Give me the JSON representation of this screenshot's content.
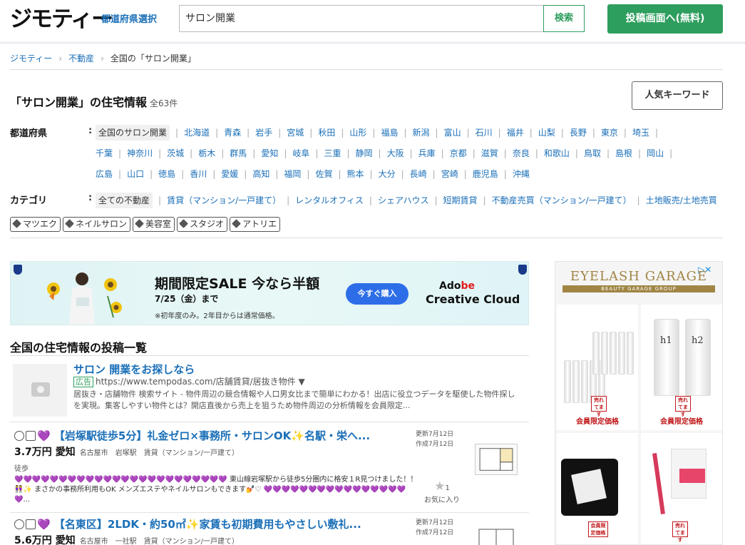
{
  "header": {
    "logo": "ジモティー",
    "pref_select": "都道府県選択",
    "search_value": "サロン開業",
    "search_btn": "検索",
    "post_btn": "投稿画面へ(無料)"
  },
  "breadcrumb": [
    "ジモティー",
    "不動産",
    "全国の「サロン開業」"
  ],
  "page": {
    "title": "「サロン開業」の住宅情報",
    "count": "全63件",
    "popular_btn": "人気キーワード"
  },
  "filters": {
    "pref_label": "都道府県",
    "pref_current": "全国のサロン開業",
    "pref_line1": [
      "北海道",
      "青森",
      "岩手",
      "宮城",
      "秋田",
      "山形",
      "福島",
      "新潟",
      "富山",
      "石川",
      "福井",
      "山梨",
      "長野",
      "東京",
      "埼玉"
    ],
    "pref_line2": [
      "千葉",
      "神奈川",
      "茨城",
      "栃木",
      "群馬",
      "愛知",
      "岐阜",
      "三重",
      "静岡",
      "大阪",
      "兵庫",
      "京都",
      "滋賀",
      "奈良",
      "和歌山",
      "鳥取",
      "島根",
      "岡山"
    ],
    "pref_line3": [
      "広島",
      "山口",
      "徳島",
      "香川",
      "愛媛",
      "高知",
      "福岡",
      "佐賀",
      "熊本",
      "大分",
      "長崎",
      "宮崎",
      "鹿児島",
      "沖縄"
    ],
    "cat_label": "カテゴリ",
    "cat_current": "全ての不動産",
    "cat_items": [
      "賃貸（マンション/一戸建て）",
      "レンタルオフィス",
      "シェアハウス",
      "短期賃貸",
      "不動産売買（マンション/一戸建て）",
      "土地販売/土地売買"
    ],
    "tags": [
      "マツエク",
      "ネイルサロン",
      "美容室",
      "スタジオ",
      "アトリエ"
    ]
  },
  "banner": {
    "title": "期間限定SALE 今なら半額",
    "sub": "7/25（金）まで",
    "note": "※初年度のみ。2年目からは通常価格。",
    "button": "今すぐ購入",
    "brand1a": "Ado",
    "brand1b": "be",
    "brand2": "Creative Cloud"
  },
  "section_title": "全国の住宅情報の投稿一覧",
  "ad_listing": {
    "title": "サロン 開業をお探しなら",
    "badge": "広告",
    "url": "https://www.tempodas.com/店舗賃貸/居抜き物件 ▼",
    "desc": "居抜き・店舗物件 検索サイト - 物件周辺の競合情報や人口男女比まで簡単にわかる！出店に役立つデータを駆使した物件探しを実現。集客しやすい物件とは？開店直後から売上を狙うため物件周辺の分析情報を会員限定..."
  },
  "listings": [
    {
      "title": "【岩塚駅徒歩5分】礼金ゼロ×事務所・サロンOK✨名駅・栄へ...",
      "price": "3.7万円",
      "pref": "愛知",
      "meta": "名古屋市　岩塚駅　賃貸（マンション/一戸建て）",
      "walk": "徒歩",
      "desc_hearts": "💜💜💜💜💜💜💜💜💜💜💜💜💜💜💜💜💜💜💜💜💜💜💜💜",
      "desc": " 東山線岩塚駅から徒歩5分圏内に格安１R見つけました！！👭✨ まさかの事務所利用もOK メンズエステやネイルサロンもできます💅♡ 💜💜💜💜💜💜💜💜💜💜💜💜💜💜💜💜💜...",
      "updated": "更新7月12日",
      "created": "作成7月12日",
      "fav_count": "1",
      "fav_label": "お気に入り"
    },
    {
      "title": "【名東区】2LDK・約50㎡✨家賃も初期費用もやさしい敷礼...",
      "price": "5.6万円",
      "pref": "愛知",
      "meta": "名古屋市　一社駅　賃貸（マンション/一戸建て）",
      "updated": "更新7月12日",
      "created": "作成7月12日"
    }
  ],
  "side_ad": {
    "brand": "EYELASH GARAGE",
    "brand_sub": "BEAUTY GARAGE GROUP",
    "adchoices": "▷✕",
    "label1": "会員限定価格",
    "label2": "会員限定価格",
    "sold": "売れてます",
    "product_h1": "h1",
    "product_h2": "h2",
    "gold_tag": "会員限定価格"
  },
  "colors": {
    "accent_green": "#2e9e5e",
    "link_blue": "#1a6fb8",
    "heart_purple": "#8a3fd8"
  }
}
